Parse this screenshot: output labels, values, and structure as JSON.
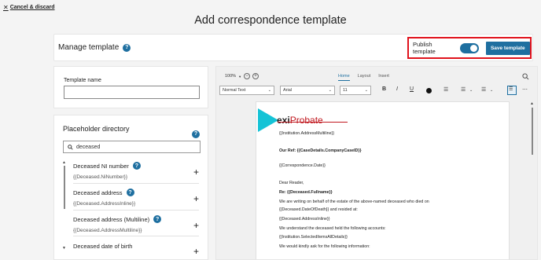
{
  "header": {
    "cancel_label": "Cancel & discard",
    "title": "Add correspondence template"
  },
  "manage": {
    "title": "Manage template",
    "publish_label": "Publish template",
    "publish_on": true,
    "save_label": "Save template"
  },
  "template_name": {
    "label": "Template name",
    "value": ""
  },
  "placeholders": {
    "title": "Placeholder directory",
    "search_value": "deceased",
    "items": [
      {
        "label": "Deceased NI number",
        "token": "{{Deceased.NiNumber}}"
      },
      {
        "label": "Deceased address",
        "token": "{{Deceased.AddressInline}}"
      },
      {
        "label": "Deceased address (Multiline)",
        "token": "{{Deceased.AddressMultiline}}"
      },
      {
        "label": "Deceased date of birth",
        "token": ""
      }
    ]
  },
  "editor": {
    "zoom": "100%",
    "tabs": [
      "Home",
      "Layout",
      "Insert"
    ],
    "active_tab": "Home",
    "style": "Normal Text",
    "font": "Arial",
    "size": "11",
    "doc": {
      "logo_prefix": "exi",
      "logo_suffix": "Probate",
      "lines": [
        "{{Institution.AddressMultiline}}",
        "Our Ref: {{CaseDetails.CompanyCaseID}}",
        "{{Correspondence.Date}}",
        "Dear Reader,",
        "Re: {{Deceased.Fullname}}",
        "We are writing on behalf of the estate of the above-named deceased who died on",
        "{{Deceased.DateOfDeath}} and resided at:",
        "{{Deceased.AddressInline}}",
        "We understand the deceased held the following accounts:",
        "{{Institution.SelectedItemsAllDetails}}",
        "We would kindly ask for the following information:"
      ]
    }
  },
  "colors": {
    "accent": "#1e6fa0",
    "highlight": "#e0121c",
    "logo_cyan": "#15c3d6",
    "logo_red": "#c0171e"
  }
}
